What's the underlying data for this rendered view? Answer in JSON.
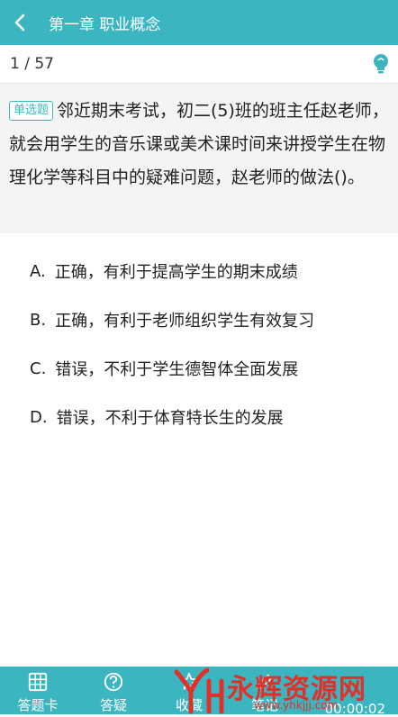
{
  "header": {
    "title": "第一章 职业概念"
  },
  "progress": {
    "counter": "1 / 57"
  },
  "question": {
    "type_badge": "单选题",
    "text": "邻近期末考试，初二(5)班的班主任赵老师，就会用学生的音乐课或美术课时间来讲授学生在物理化学等科目中的疑难问题，赵老师的做法()。"
  },
  "options": [
    {
      "letter": "A.",
      "text": "正确，有利于提高学生的期末成绩"
    },
    {
      "letter": "B.",
      "text": "正确，有利于老师组织学生有效复习"
    },
    {
      "letter": "C.",
      "text": "错误，不利于学生德智体全面发展"
    },
    {
      "letter": "D.",
      "text": "错误，不利于体育特长生的发展"
    }
  ],
  "footer": {
    "answer_card": "答题卡",
    "doubt": "答疑",
    "favorite": "收藏",
    "notes": "笔记",
    "timer": "00:00:02"
  },
  "watermark": {
    "text": "永辉资源网",
    "url": "www.yhkjjj.com"
  },
  "colors": {
    "accent": "#3bb5c0",
    "question_bg": "#f4f4f4",
    "watermark": "#e0302a"
  }
}
